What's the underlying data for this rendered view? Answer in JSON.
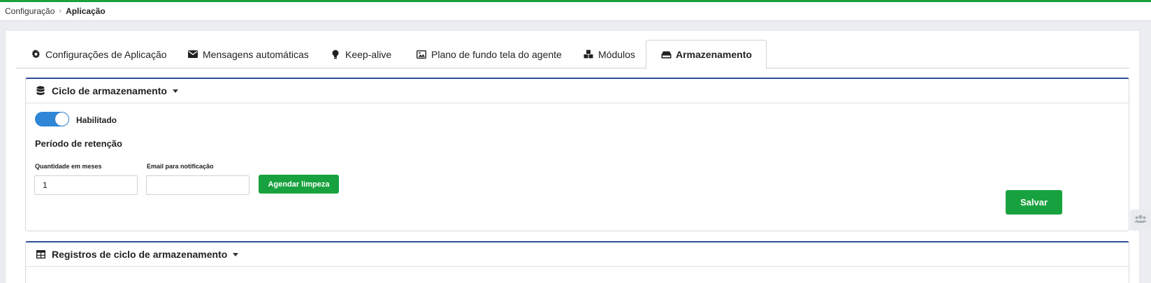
{
  "colors": {
    "accent_green": "#18a23f",
    "toggle_blue": "#2f86d6",
    "panel_top_border": "#2c4f8f"
  },
  "breadcrumb": {
    "parent": "Configuração",
    "current": "Aplicação"
  },
  "tabs": [
    {
      "label": "Configurações de Aplicação",
      "icon": "gear-icon"
    },
    {
      "label": "Mensagens automáticas",
      "icon": "envelope-icon"
    },
    {
      "label": "Keep-alive",
      "icon": "lightbulb-icon"
    },
    {
      "label": "Plano de fundo tela do agente",
      "icon": "image-icon"
    },
    {
      "label": "Módulos",
      "icon": "cubes-icon"
    },
    {
      "label": "Armazenamento",
      "icon": "hdd-icon",
      "active": true
    }
  ],
  "storage_cycle": {
    "title": "Ciclo de armazenamento",
    "icon": "database-icon",
    "toggle": {
      "label": "Habilitado",
      "enabled": true
    },
    "retention_title": "Período de retenção",
    "months": {
      "label": "Quantidade em meses",
      "value": "1"
    },
    "email": {
      "label": "Email para notificação",
      "value": ""
    },
    "schedule_label": "Agendar limpeza",
    "save_label": "Salvar"
  },
  "records_panel": {
    "title": "Registros de ciclo de armazenamento",
    "icon": "table-icon"
  },
  "side_widget": {
    "icon": "users-icon"
  }
}
